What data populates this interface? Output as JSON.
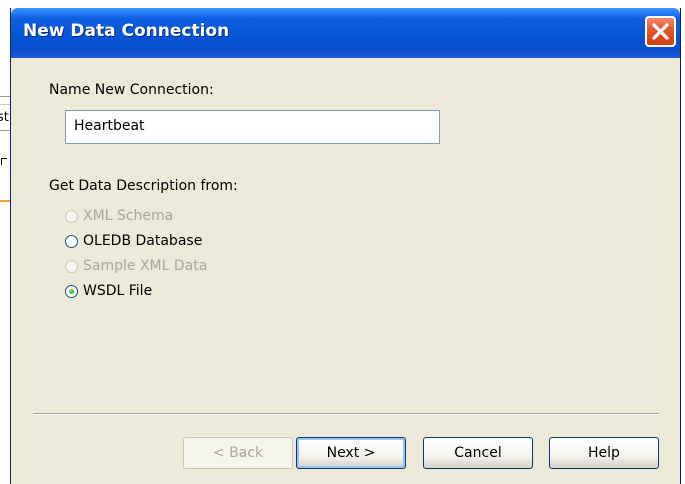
{
  "background": {
    "fragment_text": "st"
  },
  "dialog": {
    "title": "New Data Connection",
    "name_label": "Name New Connection:",
    "name_value": "Heartbeat",
    "source_label": "Get Data Description from:",
    "options": [
      {
        "label": "XML Schema",
        "enabled": false,
        "selected": false
      },
      {
        "label": "OLEDB Database",
        "enabled": true,
        "selected": false
      },
      {
        "label": "Sample XML Data",
        "enabled": false,
        "selected": false
      },
      {
        "label": "WSDL File",
        "enabled": true,
        "selected": true
      }
    ],
    "buttons": {
      "back": "< Back",
      "next": "Next >",
      "cancel": "Cancel",
      "help": "Help"
    }
  },
  "colors": {
    "titlebar": "#0556d8",
    "dialog_bg": "#ece9d8",
    "close_button": "#e35a32",
    "radio_selected": "#2fa02b",
    "disabled_text": "#aca899"
  }
}
